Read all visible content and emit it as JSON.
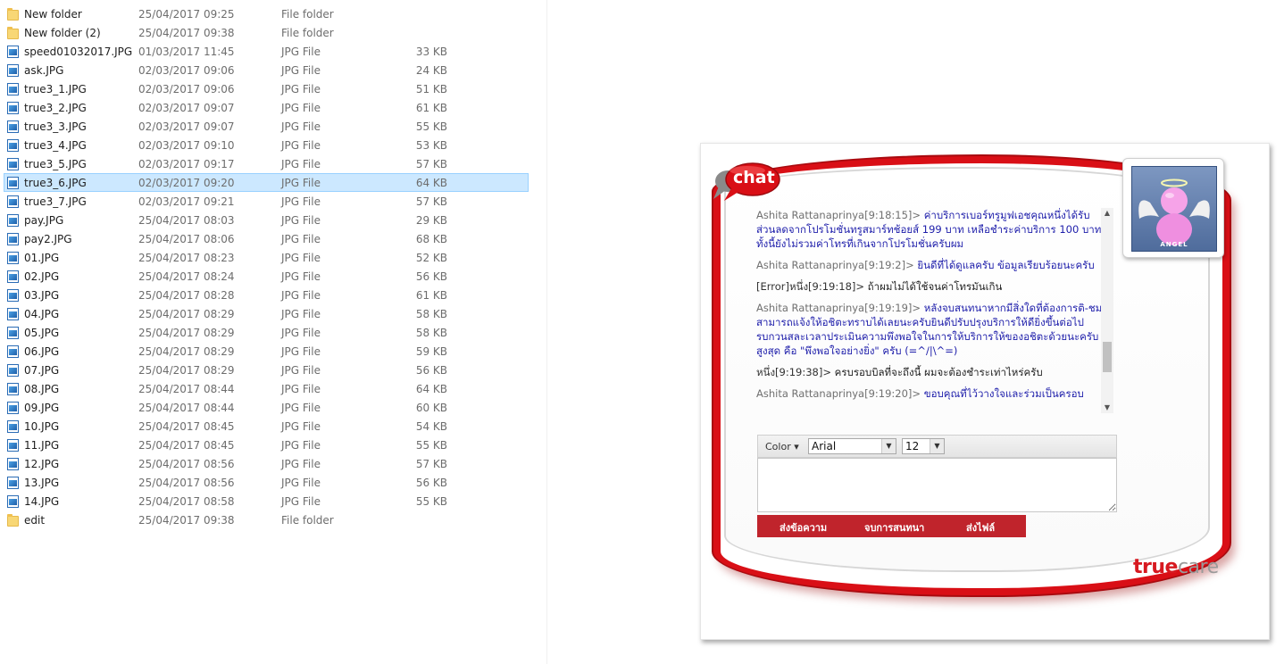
{
  "explorer": {
    "files": [
      {
        "name": "New folder",
        "date": "25/04/2017 09:25",
        "type": "File folder",
        "size": "",
        "icon": "folder-icon"
      },
      {
        "name": "New folder (2)",
        "date": "25/04/2017 09:38",
        "type": "File folder",
        "size": "",
        "icon": "folder-icon"
      },
      {
        "name": "speed01032017.JPG",
        "date": "01/03/2017 11:45",
        "type": "JPG File",
        "size": "33 KB",
        "icon": "image-file-icon"
      },
      {
        "name": "ask.JPG",
        "date": "02/03/2017 09:06",
        "type": "JPG File",
        "size": "24 KB",
        "icon": "image-file-icon"
      },
      {
        "name": "true3_1.JPG",
        "date": "02/03/2017 09:06",
        "type": "JPG File",
        "size": "51 KB",
        "icon": "image-file-icon"
      },
      {
        "name": "true3_2.JPG",
        "date": "02/03/2017 09:07",
        "type": "JPG File",
        "size": "61 KB",
        "icon": "image-file-icon"
      },
      {
        "name": "true3_3.JPG",
        "date": "02/03/2017 09:07",
        "type": "JPG File",
        "size": "55 KB",
        "icon": "image-file-icon"
      },
      {
        "name": "true3_4.JPG",
        "date": "02/03/2017 09:10",
        "type": "JPG File",
        "size": "53 KB",
        "icon": "image-file-icon"
      },
      {
        "name": "true3_5.JPG",
        "date": "02/03/2017 09:17",
        "type": "JPG File",
        "size": "57 KB",
        "icon": "image-file-icon"
      },
      {
        "name": "true3_6.JPG",
        "date": "02/03/2017 09:20",
        "type": "JPG File",
        "size": "64 KB",
        "icon": "image-file-icon",
        "selected": true
      },
      {
        "name": "true3_7.JPG",
        "date": "02/03/2017 09:21",
        "type": "JPG File",
        "size": "57 KB",
        "icon": "image-file-icon"
      },
      {
        "name": "pay.JPG",
        "date": "25/04/2017 08:03",
        "type": "JPG File",
        "size": "29 KB",
        "icon": "image-file-icon"
      },
      {
        "name": "pay2.JPG",
        "date": "25/04/2017 08:06",
        "type": "JPG File",
        "size": "68 KB",
        "icon": "image-file-icon"
      },
      {
        "name": "01.JPG",
        "date": "25/04/2017 08:23",
        "type": "JPG File",
        "size": "52 KB",
        "icon": "image-file-icon"
      },
      {
        "name": "02.JPG",
        "date": "25/04/2017 08:24",
        "type": "JPG File",
        "size": "56 KB",
        "icon": "image-file-icon"
      },
      {
        "name": "03.JPG",
        "date": "25/04/2017 08:28",
        "type": "JPG File",
        "size": "61 KB",
        "icon": "image-file-icon"
      },
      {
        "name": "04.JPG",
        "date": "25/04/2017 08:29",
        "type": "JPG File",
        "size": "58 KB",
        "icon": "image-file-icon"
      },
      {
        "name": "05.JPG",
        "date": "25/04/2017 08:29",
        "type": "JPG File",
        "size": "58 KB",
        "icon": "image-file-icon"
      },
      {
        "name": "06.JPG",
        "date": "25/04/2017 08:29",
        "type": "JPG File",
        "size": "59 KB",
        "icon": "image-file-icon"
      },
      {
        "name": "07.JPG",
        "date": "25/04/2017 08:29",
        "type": "JPG File",
        "size": "56 KB",
        "icon": "image-file-icon"
      },
      {
        "name": "08.JPG",
        "date": "25/04/2017 08:44",
        "type": "JPG File",
        "size": "64 KB",
        "icon": "image-file-icon"
      },
      {
        "name": "09.JPG",
        "date": "25/04/2017 08:44",
        "type": "JPG File",
        "size": "60 KB",
        "icon": "image-file-icon"
      },
      {
        "name": "10.JPG",
        "date": "25/04/2017 08:45",
        "type": "JPG File",
        "size": "54 KB",
        "icon": "image-file-icon"
      },
      {
        "name": "11.JPG",
        "date": "25/04/2017 08:45",
        "type": "JPG File",
        "size": "55 KB",
        "icon": "image-file-icon"
      },
      {
        "name": "12.JPG",
        "date": "25/04/2017 08:56",
        "type": "JPG File",
        "size": "57 KB",
        "icon": "image-file-icon"
      },
      {
        "name": "13.JPG",
        "date": "25/04/2017 08:56",
        "type": "JPG File",
        "size": "56 KB",
        "icon": "image-file-icon"
      },
      {
        "name": "14.JPG",
        "date": "25/04/2017 08:58",
        "type": "JPG File",
        "size": "55 KB",
        "icon": "image-file-icon"
      },
      {
        "name": "edit",
        "date": "25/04/2017 09:38",
        "type": "File folder",
        "size": "",
        "icon": "folder-icon"
      }
    ]
  },
  "chat": {
    "logo_text": "chat",
    "avatar_label": "ANGEL",
    "messages": [
      {
        "author": "Ashita Rattanaprinya[9:18:15]>",
        "text": "ค่าบริการเบอร์ทรูมูฟเอชคุณหนึ่งได้รับส่วนลดจากโปรโมชั่นทรูสมาร์ทช้อยส์ 199 บาท เหลือชำระค่าบริการ 100 บาท ทั้งนี้ยังไม่รวมค่าโทรที่เกินจากโปรโมชั่นครับผม",
        "role": "agent"
      },
      {
        "author": "Ashita Rattanaprinya[9:19:2]>",
        "text": "ยินดีที่ได้ดูแลครับ ข้อมูลเรียบร้อยนะครับ",
        "role": "agent"
      },
      {
        "author": "[Error]หนึ่ง[9:19:18]>",
        "text": "ถ้าผมไม่ได้ใช้จนค่าโทรมันเกิน",
        "role": "user"
      },
      {
        "author": "Ashita Rattanaprinya[9:19:19]>",
        "text": "หลังจบสนทนาหากมีสิ่งใดที่ต้องการติ-ชม สามารถแจ้งให้อชิตะทราบได้เลยนะครับยินดีปรับปรุงบริการให้ดียิ่งขึ้นต่อไป รบกวนสละเวลาประเมินความพึงพอใจในการให้บริการให้ของอชิตะด้วยนะครับ สูงสุด คือ \"พึงพอใจอย่างยิ่ง\" ครับ (=^/|\\^=)",
        "role": "agent"
      },
      {
        "author": "หนึ่ง[9:19:38]>",
        "text": "ครบรอบบิลที่จะถึงนี้ ผมจะต้องชำระเท่าไหร่ครับ",
        "role": "user"
      },
      {
        "author": "Ashita Rattanaprinya[9:19:20]>",
        "text": "ขอบคุณที่ไว้วางใจและร่วมเป็นครอบ",
        "role": "agent"
      }
    ],
    "toolbar": {
      "color_label": "Color ▾",
      "font_value": "Arial",
      "size_value": "12"
    },
    "input_placeholder": "",
    "actions": {
      "send_label": "ส่งข้อความ",
      "end_label": "จบการสนทนา",
      "file_label": "ส่งไฟล์"
    },
    "brand": {
      "true": "true",
      "care": "care"
    },
    "colors": {
      "accent": "#d90f16",
      "agent_text": "#1d1daa",
      "action_bar": "#c0242c",
      "selection": "#cce8ff"
    }
  }
}
